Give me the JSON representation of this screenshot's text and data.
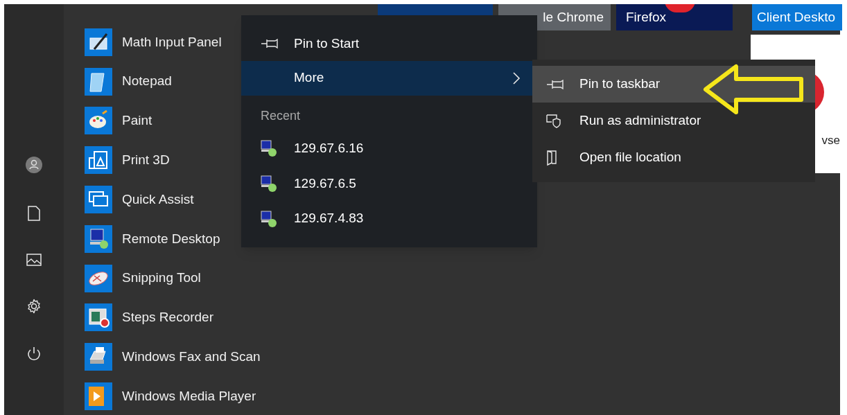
{
  "rail": [
    {
      "kind": "avatar"
    },
    {
      "kind": "documents"
    },
    {
      "kind": "pictures"
    },
    {
      "kind": "settings"
    },
    {
      "kind": "power"
    }
  ],
  "apps": [
    {
      "label": "Math Input Panel",
      "kind": "math"
    },
    {
      "label": "Notepad",
      "kind": "notepad"
    },
    {
      "label": "Paint",
      "kind": "paint"
    },
    {
      "label": "Print 3D",
      "kind": "print3d"
    },
    {
      "label": "Quick Assist",
      "kind": "quickassist"
    },
    {
      "label": "Remote Desktop",
      "kind": "rdp"
    },
    {
      "label": "Snipping Tool",
      "kind": "snipping"
    },
    {
      "label": "Steps Recorder",
      "kind": "steps"
    },
    {
      "label": "Windows Fax and Scan",
      "kind": "fax"
    },
    {
      "label": "Windows Media Player",
      "kind": "media"
    }
  ],
  "tiles": [
    {
      "kind": "plain",
      "color": "#0b3a7a"
    },
    {
      "kind": "text",
      "label": "le Chrome",
      "color": "#5f6368"
    },
    {
      "kind": "firefox",
      "label": "Firefox",
      "color": "#0a1a55"
    },
    {
      "kind": "text",
      "label": "Client Deskto",
      "color": "#0a78d7"
    }
  ],
  "side_panel": {
    "text": "vse"
  },
  "context_menu": {
    "items": [
      {
        "kind": "pin",
        "label": "Pin to Start",
        "selected": false
      },
      {
        "kind": "more",
        "label": "More",
        "selected": true
      }
    ],
    "recent_header": "Recent",
    "recent": [
      "129.67.6.16",
      "129.67.6.5",
      "129.67.4.83"
    ]
  },
  "submenu": {
    "items": [
      {
        "kind": "pin",
        "label": "Pin to taskbar",
        "selected": true
      },
      {
        "kind": "admin",
        "label": "Run as administrator",
        "selected": false
      },
      {
        "kind": "folder",
        "label": "Open file location",
        "selected": false
      }
    ]
  }
}
